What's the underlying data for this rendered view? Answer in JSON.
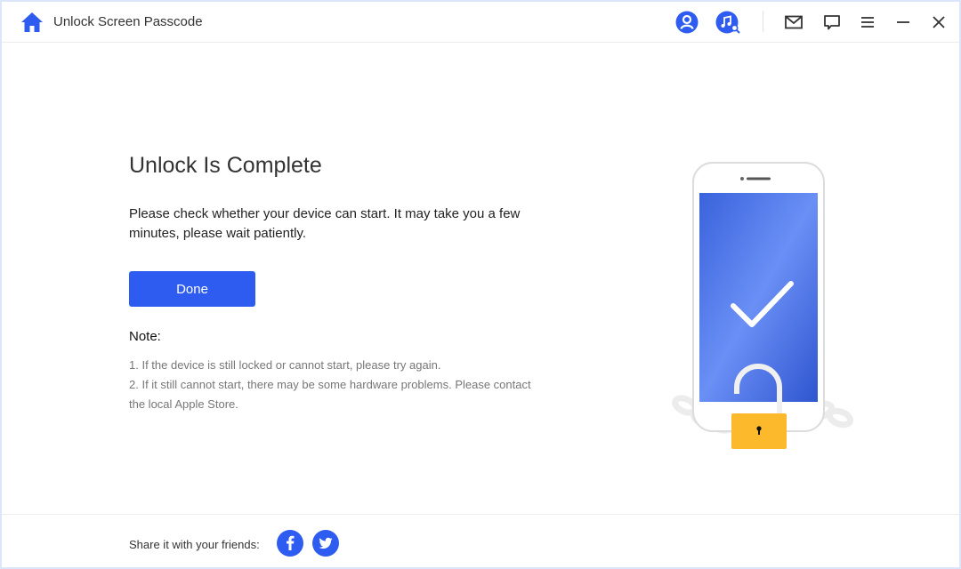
{
  "window": {
    "title": "Unlock Screen Passcode",
    "accent_color": "#2f5cf0"
  },
  "titlebar": {
    "icons": [
      {
        "name": "home-icon"
      },
      {
        "name": "account-icon"
      },
      {
        "name": "music-search-icon"
      },
      {
        "name": "mail-icon"
      },
      {
        "name": "feedback-icon"
      },
      {
        "name": "menu-icon"
      },
      {
        "name": "minimize-icon"
      },
      {
        "name": "close-icon"
      }
    ]
  },
  "main": {
    "heading": "Unlock Is Complete",
    "description": "Please check whether your device can start. It may take you a few minutes, please wait patiently.",
    "done_label": "Done",
    "note_title": "Note:",
    "notes": [
      "1. If the device is still locked or cannot start, please try again.",
      "2. If it still cannot start, there may be some hardware problems. Please contact the local Apple Store."
    ]
  },
  "footer": {
    "share_label": "Share it with your friends:",
    "social": [
      {
        "name": "facebook-icon",
        "glyph": "f"
      },
      {
        "name": "twitter-icon"
      }
    ]
  }
}
